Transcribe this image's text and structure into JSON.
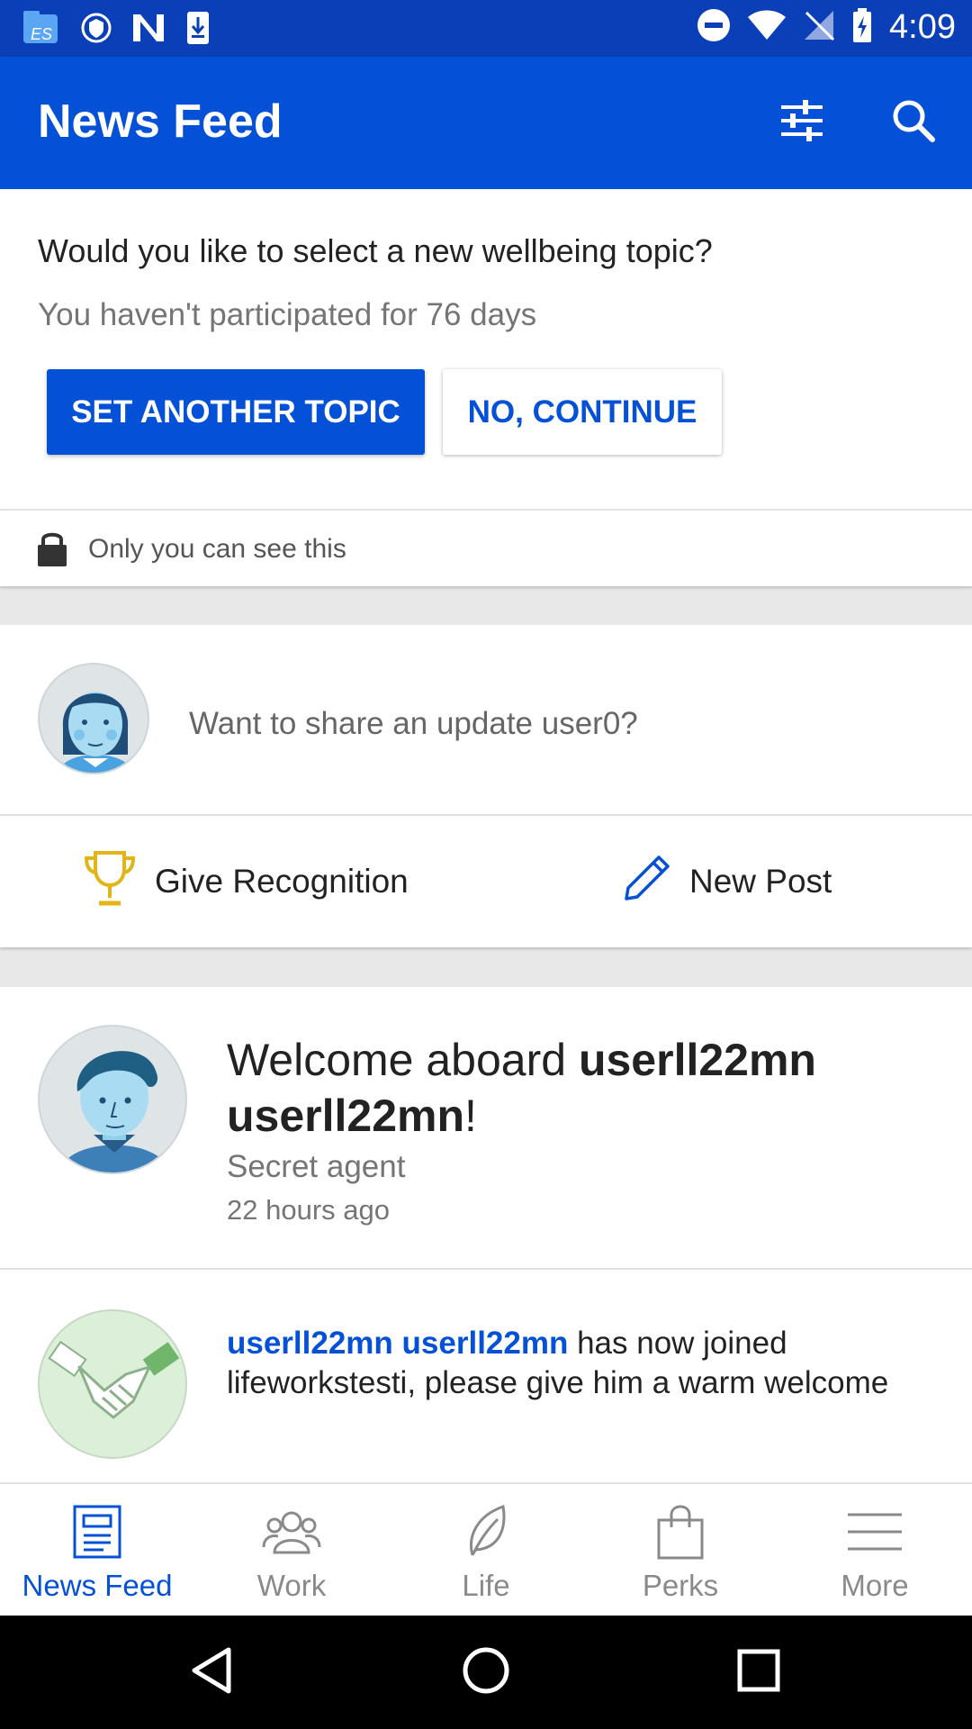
{
  "status_bar": {
    "time": "4:09"
  },
  "app_bar": {
    "title": "News Feed"
  },
  "topic_prompt": {
    "question": "Would you like to select a new wellbeing topic?",
    "subtext": "You haven't participated for 76 days",
    "primary_button": "SET ANOTHER TOPIC",
    "secondary_button": "NO, CONTINUE"
  },
  "privacy_note": "Only you can see this",
  "share": {
    "placeholder": "Want to share an update user0?",
    "give_recognition": "Give Recognition",
    "new_post": "New Post"
  },
  "welcome_post": {
    "prefix": "Welcome aboard ",
    "name": "userll22mn userll22mn",
    "suffix": "!",
    "role": "Secret agent",
    "time": "22 hours ago"
  },
  "join_post": {
    "name_link": "userll22mn userll22mn",
    "text": " has now joined lifeworkstesti, please give him a warm welcome"
  },
  "bottom_nav": {
    "items": [
      {
        "label": "News Feed",
        "icon": "newsfeed-icon",
        "active": true
      },
      {
        "label": "Work",
        "icon": "people-icon"
      },
      {
        "label": "Life",
        "icon": "leaf-icon"
      },
      {
        "label": "Perks",
        "icon": "bag-icon"
      },
      {
        "label": "More",
        "icon": "menu-icon"
      }
    ]
  },
  "colors": {
    "primary": "#0451d8",
    "status_bar": "#0a3fb8",
    "trophy": "#e2b417"
  }
}
